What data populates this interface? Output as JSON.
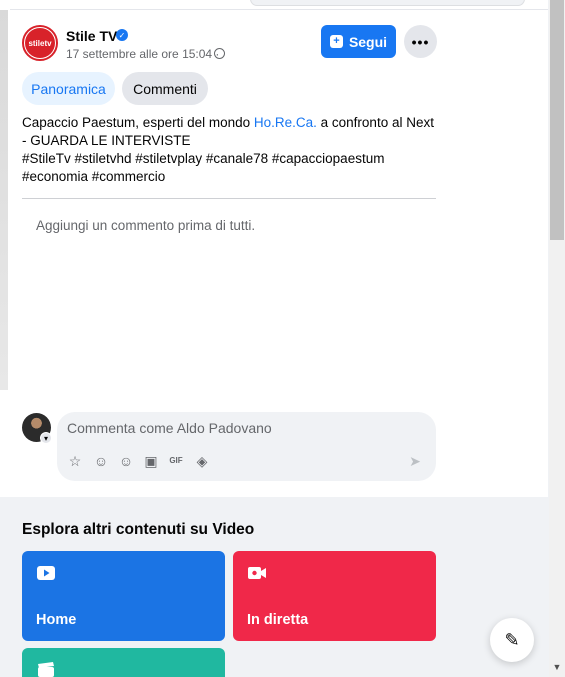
{
  "post": {
    "page_name": "Stile TV",
    "avatar_text": "stiletv",
    "verified_mark": "✓",
    "date": "17 settembre alle ore 15:04 ·",
    "follow_label": "Segui",
    "more_label": "•••",
    "text_before_link": "Capaccio Paestum, esperti del mondo ",
    "link_text": "Ho.Re.Ca.",
    "text_after_link": " a confronto al Next - GUARDA LE INTERVISTE",
    "hashtags": "#StileTv #stiletvhd #stiletvplay #canale78 #capacciopaestum #economia #commercio"
  },
  "tabs": [
    {
      "label": "Panoramica",
      "active": true
    },
    {
      "label": "Commenti",
      "active": false
    }
  ],
  "comments": {
    "empty_message": "Aggiungi un commento prima di tutti.",
    "input_placeholder": "Commenta come Aldo Padovano",
    "toolbar_icons": [
      "avatar-sticker-icon",
      "cool-face-icon",
      "emoji-icon",
      "camera-icon",
      "gif-icon",
      "sticker-icon"
    ],
    "send_icon": "send-icon"
  },
  "explore": {
    "title": "Esplora altri contenuti su Video",
    "tiles": [
      {
        "label": "Home",
        "icon": "video-play-icon",
        "color": "#1b74e4"
      },
      {
        "label": "In diretta",
        "icon": "live-camera-icon",
        "color": "#f02849"
      },
      {
        "label": "",
        "icon": "clapperboard-icon",
        "color": "#20b8a0"
      }
    ]
  },
  "colors": {
    "accent": "#1877f2",
    "text_secondary": "#65676b"
  }
}
